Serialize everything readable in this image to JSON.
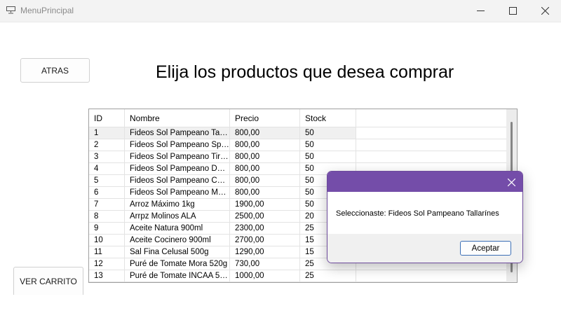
{
  "window": {
    "title": "MenuPrincipal"
  },
  "buttons": {
    "back": "ATRAS",
    "cart": "VER CARRITO"
  },
  "heading": "Elija los productos que desea comprar",
  "table": {
    "columns": [
      "ID",
      "Nombre",
      "Precio",
      "Stock"
    ],
    "rows": [
      [
        "1",
        "Fideos Sol Pampeano Talla...",
        "800,00",
        "50"
      ],
      [
        "2",
        "Fideos Sol Pampeano Spa...",
        "800,00",
        "50"
      ],
      [
        "3",
        "Fideos Sol Pampeano Tira...",
        "800,00",
        "50"
      ],
      [
        "4",
        "Fideos Sol Pampeano Dedal",
        "800,00",
        "50"
      ],
      [
        "5",
        "Fideos Sol Pampeano Codo",
        "800,00",
        "50"
      ],
      [
        "6",
        "Fideos Sol Pampeano Most...",
        "800,00",
        "50"
      ],
      [
        "7",
        "Arroz Máximo 1kg",
        "1900,00",
        "50"
      ],
      [
        "8",
        "Arrpz Molinos ALA",
        "2500,00",
        "20"
      ],
      [
        "9",
        "Aceite Natura 900ml",
        "2300,00",
        "25"
      ],
      [
        "10",
        "Aceite Cocinero 900ml",
        "2700,00",
        "15"
      ],
      [
        "11",
        "Sal Fina Celusal 500g",
        "1290,00",
        "15"
      ],
      [
        "12",
        "Puré de Tomate Mora 520g",
        "730,00",
        "25"
      ],
      [
        "13",
        "Puré de Tomate INCAA 520g",
        "1000,00",
        "25"
      ]
    ]
  },
  "dialog": {
    "message": "Seleccionaste: Fideos Sol Pampeano Tallarínes",
    "ok_label": "Aceptar"
  },
  "colors": {
    "dialog_title": "#744da9",
    "selected_row": "#f0f0f0"
  }
}
